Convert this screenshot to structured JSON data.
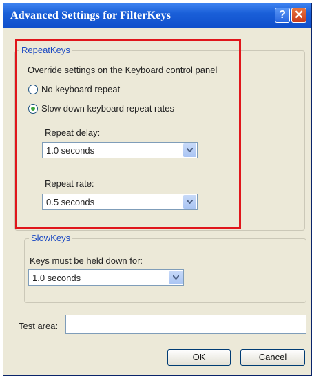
{
  "window": {
    "title": "Advanced Settings for FilterKeys"
  },
  "titlebar_buttons": {
    "help": "?",
    "close": "✕"
  },
  "repeatkeys": {
    "legend": "RepeatKeys",
    "description": "Override settings on the Keyboard control panel",
    "options": [
      {
        "label": "No keyboard repeat",
        "selected": false
      },
      {
        "label": "Slow down keyboard repeat rates",
        "selected": true
      }
    ],
    "repeat_delay": {
      "label": "Repeat delay:",
      "value": "1.0 seconds"
    },
    "repeat_rate": {
      "label": "Repeat rate:",
      "value": "0.5 seconds"
    }
  },
  "slowkeys": {
    "legend": "SlowKeys",
    "label": "Keys must be held down for:",
    "value": "1.0 seconds"
  },
  "test_area": {
    "label": "Test area:",
    "value": ""
  },
  "buttons": {
    "ok": "OK",
    "cancel": "Cancel"
  },
  "colors": {
    "title_bar": "#1a5fd8",
    "dialog_bg": "#ece9d8",
    "highlight": "#e0161b",
    "legend_text": "#1b49c2"
  }
}
